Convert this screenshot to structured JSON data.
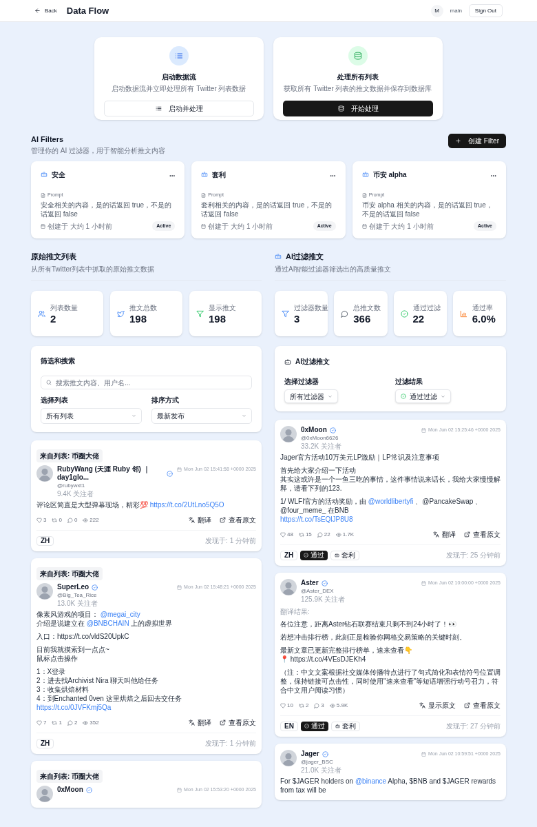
{
  "header": {
    "back": "Back",
    "title": "Data Flow",
    "avatar_letter": "M",
    "user": "main",
    "sign_out": "Sign Out"
  },
  "actions": [
    {
      "title": "启动数据流",
      "desc": "启动数据流并立即处理所有 Twitter 列表数据",
      "button": "启动并处理",
      "primary": false
    },
    {
      "title": "处理所有列表",
      "desc": "获取所有 Twitter 列表的推文数据并保存到数据库",
      "button": "开始处理",
      "primary": true
    }
  ],
  "ai_filters": {
    "title": "AI Filters",
    "subtitle": "管理你的 AI 过滤器，用于智能分析推文内容",
    "create": "创建 Filter",
    "more": "...",
    "items": [
      {
        "name": "安全",
        "prompt_label": "Prompt",
        "prompt": "安全相关的内容，是的话返回 true，不是的话返回 false",
        "created": "创建于 大约 1 小时前",
        "status": "Active"
      },
      {
        "name": "套利",
        "prompt_label": "Prompt",
        "prompt": "套利相关的内容，是的话返回 true，不是的话返回 false",
        "created": "创建于 大约 1 小时前",
        "status": "Active"
      },
      {
        "name": "币安 alpha",
        "prompt_label": "Prompt",
        "prompt": "币安 alpha 相关的内容，是的话返回 true，不是的话返回 false",
        "created": "创建于 大约 1 小时前",
        "status": "Active"
      }
    ]
  },
  "raw": {
    "title": "原始推文列表",
    "subtitle": "从所有Twitter列表中抓取的原始推文数据",
    "stats": [
      {
        "label": "列表数量",
        "value": "2"
      },
      {
        "label": "推文总数",
        "value": "198"
      },
      {
        "label": "显示推文",
        "value": "198"
      }
    ],
    "panel": {
      "title": "筛选和搜索",
      "search_placeholder": "搜索推文内容、用户名...",
      "list_label": "选择列表",
      "list_value": "所有列表",
      "sort_label": "排序方式",
      "sort_value": "最新发布"
    },
    "tweets": [
      {
        "source": "来自列表: 币圈大佬",
        "name": "RubyWang (天涯 Ruby 邻) ｜day1glo...",
        "handle": "@rubywxt1",
        "followers": "9.4K 关注者",
        "date": "Mon Jun 02 15:41:58 +0000 2025",
        "body": [
          [
            [
              {
                "t": "评论区简直是大型弹幕现场，精彩💯 "
              },
              {
                "t": "https://t.co/2UtLno5Q5O",
                "link": true
              }
            ]
          ]
        ],
        "likes": "3",
        "retweets": "0",
        "replies": "0",
        "views": "222",
        "translate": "翻译",
        "open": "查看原文",
        "tags": [
          {
            "kind": "lang",
            "text": "ZH"
          }
        ],
        "found": "发现于: 1 分钟前"
      },
      {
        "source": "来自列表: 币圈大佬",
        "name": "SuperLeo",
        "handle": "@Big_Tea_Rice",
        "followers": "13.0K 关注者",
        "date": "Mon Jun 02 15:48:21 +0000 2025",
        "body": [
          [
            [
              {
                "t": "像素风游戏的项目： "
              },
              {
                "t": "@megai_city",
                "link": true
              }
            ],
            [
              {
                "t": "介绍是说建立在 "
              },
              {
                "t": "@BNBCHAIN",
                "link": true
              },
              {
                "t": " 上的虚拟世界"
              }
            ]
          ],
          [
            [
              {
                "t": "入口：https://t.co/vldS20UpkC"
              }
            ]
          ],
          [
            [
              {
                "t": "目前我就摸索到一点点~"
              }
            ],
            [
              {
                "t": "鼠标点击操作"
              }
            ]
          ],
          [
            [
              {
                "t": "1：X登录"
              }
            ],
            [
              {
                "t": "2：进去找Archivist Nira 聊天叫他给任务"
              }
            ],
            [
              {
                "t": "3：收集烘焙材料"
              }
            ],
            [
              {
                "t": "4：到Enchanted 0ven 这里烘焙之后回去交任务 "
              },
              {
                "t": "https://t.co/0JVFKmj5Qa",
                "link": true
              }
            ]
          ]
        ],
        "likes": "7",
        "retweets": "1",
        "replies": "2",
        "views": "352",
        "translate": "翻译",
        "open": "查看原文",
        "tags": [
          {
            "kind": "lang",
            "text": "ZH"
          }
        ],
        "found": "发现于: 1 分钟前"
      },
      {
        "source": "来自列表: 币圈大佬",
        "name": "0xMoon",
        "date": "Mon Jun 02 15:53:20 +0000 2025",
        "partial": true
      }
    ]
  },
  "ai": {
    "title": "AI过滤推文",
    "subtitle": "通过AI智能过滤器筛选出的高质量推文",
    "stats": [
      {
        "label": "过滤器数量",
        "value": "3"
      },
      {
        "label": "总推文数",
        "value": "366"
      },
      {
        "label": "通过过滤",
        "value": "22"
      },
      {
        "label": "通过率",
        "value": "6.0%"
      }
    ],
    "panel": {
      "title": "AI过滤推文",
      "filter_label": "选择过滤器",
      "filter_value": "所有过滤器",
      "result_label": "过滤结果",
      "result_value": "通过过滤"
    },
    "tweets": [
      {
        "name": "0xMoon",
        "handle": "@0xMoon6626",
        "followers": "33.2K 关注者",
        "date": "Mon Jun 02 15:25:46 +0000 2025",
        "body": [
          [
            [
              {
                "t": "Jager官方活动10万美元LP激励｜LP常识及注意事项"
              }
            ]
          ],
          [
            [
              {
                "t": "首先给大家介绍一下活动"
              }
            ],
            [
              {
                "t": "其实这或许是一个一鱼三吃的事情，这件事情说来话长，我给大家慢慢解释，请看下列的123."
              }
            ]
          ],
          [
            [
              {
                "t": "1/ WLFI官方的活动奖励，由 "
              },
              {
                "t": "@worldlibertyfi",
                "link": true
              },
              {
                "t": " 、@PancakeSwap 、@four_meme_ 在BNB"
              }
            ],
            [
              {
                "t": "https://t.co/TsEQlJP8U8",
                "link": true
              }
            ]
          ]
        ],
        "likes": "48",
        "retweets": "15",
        "replies": "22",
        "views": "1.7K",
        "translate": "翻译",
        "open": "查看原文",
        "tags": [
          {
            "kind": "lang",
            "text": "ZH"
          },
          {
            "kind": "pass",
            "text": "通过"
          },
          {
            "kind": "filter",
            "text": "套利"
          }
        ],
        "found": "发现于: 25 分钟前"
      },
      {
        "name": "Aster",
        "handle": "@Aster_DEX",
        "followers": "125.9K 关注者",
        "date": "Mon Jun 02 10:00:00 +0000 2025",
        "translation_label": "翻译结果:",
        "body": [
          [
            [
              {
                "t": "各位注意，距离Aster钻石联赛结束只剩不到24小时了！👀"
              }
            ]
          ],
          [
            [
              {
                "t": "若想冲击排行榜，此刻正是检验你网格交易策略的关键时刻。"
              }
            ]
          ],
          [
            [
              {
                "t": "最新文章已更新完整排行榜单，速来查看👇"
              }
            ],
            [
              {
                "t": "📍 https://t.co/4VEsDJEKh4"
              }
            ]
          ],
          [
            [
              {
                "t": "（注：中文文案根据社交媒体传播特点进行了句式简化和表情符号位置调整，保持链接可点击性，同时使用\"速来查看\"等短语增强行动号召力，符合中文用户阅读习惯）"
              }
            ]
          ]
        ],
        "likes": "10",
        "retweets": "2",
        "replies": "3",
        "views": "5.9K",
        "translate": "显示原文",
        "open": "查看原文",
        "tags": [
          {
            "kind": "lang",
            "text": "EN"
          },
          {
            "kind": "pass",
            "text": "通过"
          },
          {
            "kind": "filter",
            "text": "套利"
          }
        ],
        "found": "发现于: 27 分钟前"
      },
      {
        "name": "Jager",
        "handle": "@jager_BSC",
        "followers": "21.0K 关注者",
        "date": "Mon Jun 02 10:59:51 +0000 2025",
        "body": [
          [
            [
              {
                "t": "For $JAGER holders on "
              },
              {
                "t": "@binance",
                "link": true
              },
              {
                "t": " Alpha, $BNB and $JAGER rewards from tax will be"
              }
            ]
          ]
        ],
        "partial": true
      }
    ]
  }
}
